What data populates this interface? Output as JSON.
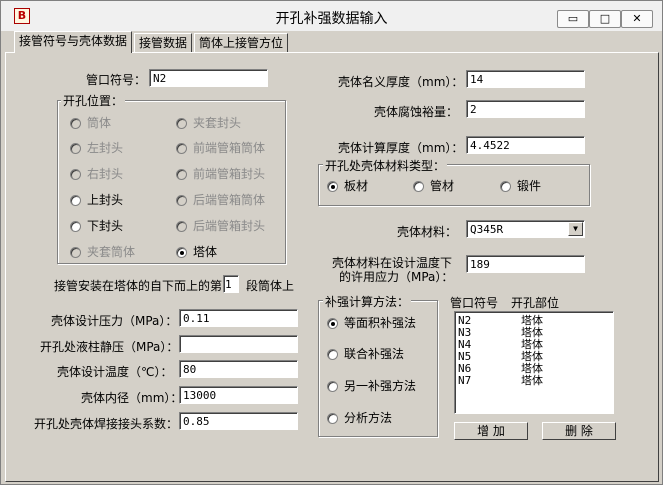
{
  "window": {
    "title": "开孔补强数据输入",
    "app_icon": "B"
  },
  "caption": {
    "minimize": "▭",
    "maximize": "□",
    "close": "✕"
  },
  "tabs": [
    "接管符号与壳体数据",
    "接管数据",
    "筒体上接管方位"
  ],
  "nozzle_symbol": {
    "label": "管口符号：",
    "value": "N2"
  },
  "opening_position": {
    "title": "开孔位置：",
    "options": [
      {
        "label": "筒体",
        "enabled": false,
        "checked": false
      },
      {
        "label": "夹套封头",
        "enabled": false,
        "checked": false
      },
      {
        "label": "左封头",
        "enabled": false,
        "checked": false
      },
      {
        "label": "前端管箱筒体",
        "enabled": false,
        "checked": false
      },
      {
        "label": "右封头",
        "enabled": false,
        "checked": false
      },
      {
        "label": "前端管箱封头",
        "enabled": false,
        "checked": false
      },
      {
        "label": "上封头",
        "enabled": true,
        "checked": false
      },
      {
        "label": "后端管箱筒体",
        "enabled": false,
        "checked": false
      },
      {
        "label": "下封头",
        "enabled": true,
        "checked": false
      },
      {
        "label": "后端管箱封头",
        "enabled": false,
        "checked": false
      },
      {
        "label": "夹套筒体",
        "enabled": false,
        "checked": false
      },
      {
        "label": "塔体",
        "enabled": true,
        "checked": true
      }
    ]
  },
  "segment": {
    "prefix": "接管安装在塔体的自下而上的第",
    "value": "1",
    "suffix": "段筒体上"
  },
  "left_fields": [
    {
      "label": "壳体设计压力（MPa）：",
      "value": "0.11"
    },
    {
      "label": "开孔处液柱静压（MPa）：",
      "value": ""
    },
    {
      "label": "壳体设计温度（℃）：",
      "value": "80"
    },
    {
      "label": "壳体内径（mm）：",
      "value": "13000"
    },
    {
      "label": "开孔处壳体焊接接头系数：",
      "value": "0.85"
    }
  ],
  "right_fields": {
    "nominal_thickness": {
      "label": "壳体名义厚度（mm）：",
      "value": "14"
    },
    "corrosion": {
      "label": "壳体腐蚀裕量：",
      "value": "2"
    },
    "calc_thickness": {
      "label": "壳体计算厚度（mm）：",
      "value": "4.4522"
    }
  },
  "material_type": {
    "title": "开孔处壳体材料类型：",
    "options": [
      {
        "label": "板材",
        "checked": true
      },
      {
        "label": "管材",
        "checked": false
      },
      {
        "label": "锻件",
        "checked": false
      }
    ]
  },
  "shell_material": {
    "label": "壳体材料：",
    "value": "Q345R"
  },
  "allowable_stress": {
    "label_line1": "壳体材料在设计温度下",
    "label_line2": "的许用应力（MPa）：",
    "value": "189"
  },
  "reinforcement": {
    "title": "补强计算方法：",
    "options": [
      {
        "label": "等面积补强法",
        "checked": true
      },
      {
        "label": "联合补强法",
        "checked": false
      },
      {
        "label": "另一补强方法",
        "checked": false
      },
      {
        "label": "分析方法",
        "checked": false
      }
    ]
  },
  "nozzle_list": {
    "headers": [
      "管口符号",
      "开孔部位"
    ],
    "rows": [
      [
        "N2",
        "塔体"
      ],
      [
        "N3",
        "塔体"
      ],
      [
        "N4",
        "塔体"
      ],
      [
        "N5",
        "塔体"
      ],
      [
        "N6",
        "塔体"
      ],
      [
        "N7",
        "塔体"
      ]
    ]
  },
  "buttons": {
    "add": "增 加",
    "delete": "删 除"
  }
}
